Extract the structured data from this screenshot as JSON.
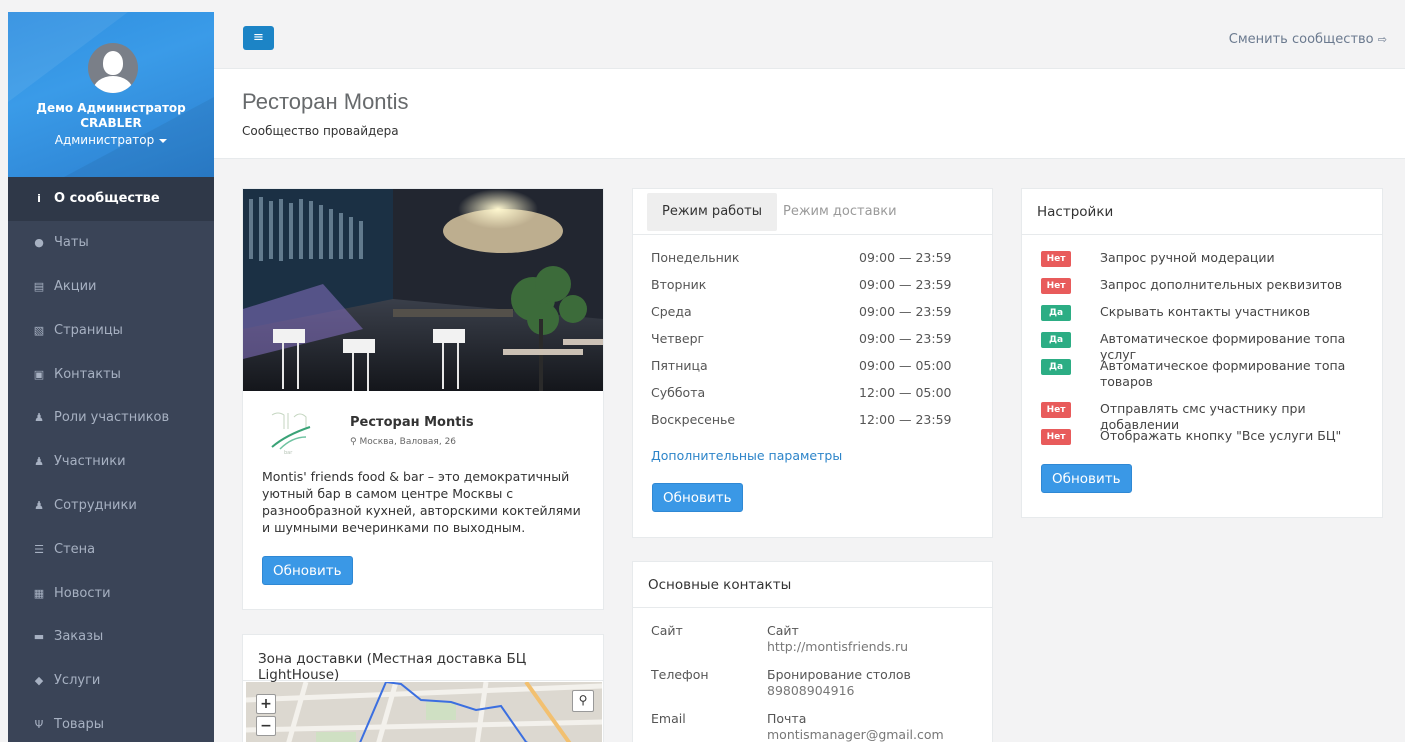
{
  "sidebar": {
    "profile": {
      "name": "Демо Администратор",
      "org": "CRABLER",
      "role": "Администратор"
    },
    "items": [
      {
        "icon": "info-icon",
        "glyph": "i",
        "label": "О сообществе",
        "active": true
      },
      {
        "icon": "comments-icon",
        "glyph": "●",
        "label": "Чаты"
      },
      {
        "icon": "file-icon",
        "glyph": "▤",
        "label": "Акции"
      },
      {
        "icon": "file-image-icon",
        "glyph": "▧",
        "label": "Страницы"
      },
      {
        "icon": "address-book-icon",
        "glyph": "▣",
        "label": "Контакты"
      },
      {
        "icon": "users-icon",
        "glyph": "♟",
        "label": "Роли участников"
      },
      {
        "icon": "users-icon",
        "glyph": "♟",
        "label": "Участники"
      },
      {
        "icon": "users-icon",
        "glyph": "♟",
        "label": "Сотрудники"
      },
      {
        "icon": "list-icon",
        "glyph": "☰",
        "label": "Стена"
      },
      {
        "icon": "newspaper-icon",
        "glyph": "▦",
        "label": "Новости"
      },
      {
        "icon": "cart-icon",
        "glyph": "▬",
        "label": "Заказы"
      },
      {
        "icon": "car-icon",
        "glyph": "◆",
        "label": "Услуги"
      },
      {
        "icon": "cutlery-icon",
        "glyph": "Ψ",
        "label": "Товары"
      }
    ]
  },
  "topbar": {
    "menu_glyph": "≡",
    "switch_label": "Сменить сообщество"
  },
  "header": {
    "title": "Ресторан Montis",
    "subtitle": "Сообщество провайдера"
  },
  "restaurant": {
    "name": "Ресторан Montis",
    "address": "Москва, Валовая, 26",
    "description": "Montis' friends food & bar – это демократичный уютный бар в самом центре Москвы с разнообразной кухней, авторскими коктейлями и шумными вечеринками по выходным.",
    "update_label": "Обновить"
  },
  "delivery_zone": {
    "title": "Зона доставки (Местная доставка БЦ LightHouse)",
    "zoom_in": "+",
    "zoom_out": "−"
  },
  "schedule": {
    "tabs": [
      "Режим работы",
      "Режим доставки"
    ],
    "rows": [
      {
        "day": "Понедельник",
        "time": "09:00 — 23:59"
      },
      {
        "day": "Вторник",
        "time": "09:00 — 23:59"
      },
      {
        "day": "Среда",
        "time": "09:00 — 23:59"
      },
      {
        "day": "Четверг",
        "time": "09:00 — 23:59"
      },
      {
        "day": "Пятница",
        "time": "09:00 — 05:00"
      },
      {
        "day": "Суббота",
        "time": "12:00 — 05:00"
      },
      {
        "day": "Воскресенье",
        "time": "12:00 — 23:59"
      }
    ],
    "extra_link": "Дополнительные параметры",
    "update_label": "Обновить"
  },
  "contacts": {
    "title": "Основные контакты",
    "rows": [
      {
        "label": "Сайт",
        "name": "Сайт",
        "value": "http://montisfriends.ru"
      },
      {
        "label": "Телефон",
        "name": "Бронирование столов",
        "value": "89808904916"
      },
      {
        "label": "Email",
        "name": "Почта",
        "value": "montismanager@gmail.com"
      }
    ]
  },
  "settings": {
    "title": "Настройки",
    "items": [
      {
        "badge": "Нет",
        "state": "no",
        "text": "Запрос ручной модерации"
      },
      {
        "badge": "Нет",
        "state": "no",
        "text": "Запрос дополнительных реквизитов"
      },
      {
        "badge": "Да",
        "state": "yes",
        "text": "Скрывать контакты участников"
      },
      {
        "badge": "Да",
        "state": "yes",
        "text": "Автоматическое формирование топа услуг"
      },
      {
        "badge": "Да",
        "state": "yes",
        "text": "Автоматическое формирование топа товаров"
      },
      {
        "badge": "Нет",
        "state": "no",
        "text": "Отправлять смс участнику при добавлении"
      },
      {
        "badge": "Нет",
        "state": "no",
        "text": "Отображать кнопку \"Все услуги БЦ\""
      }
    ],
    "update_label": "Обновить"
  },
  "colors": {
    "accent": "#3a98e6",
    "sidebar_bg": "#3a4457",
    "badge_no": "#e85b5b",
    "badge_yes": "#2cad84"
  }
}
